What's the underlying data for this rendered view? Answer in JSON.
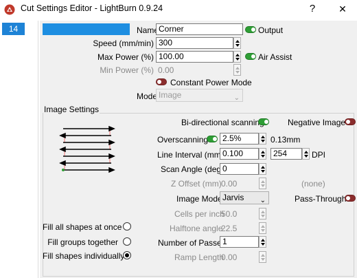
{
  "window": {
    "title": "Cut Settings Editor - LightBurn 0.9.24",
    "help_glyph": "?",
    "close_glyph": "✕",
    "app_icon": "lightburn-app-icon"
  },
  "layer": {
    "number": "14",
    "color": "#1e8ee1"
  },
  "fields": {
    "name_label": "Name",
    "name_value": "Corner",
    "output_label": "Output",
    "speed_label": "Speed (mm/min)",
    "speed_value": "300",
    "max_power_label": "Max Power (%)",
    "max_power_value": "100.00",
    "air_assist_label": "Air Assist",
    "min_power_label": "Min Power (%)",
    "min_power_value": "0.00",
    "constant_power_label": "Constant Power Mode",
    "mode_label": "Mode",
    "mode_value": "Image"
  },
  "image_settings": {
    "group_title": "Image Settings",
    "bidirectional_label": "Bi-directional scanning",
    "negative_image_label": "Negative Image",
    "overscanning_label": "Overscanning",
    "overscanning_value": "2.5%",
    "overscanning_mm": "0.13mm",
    "line_interval_label": "Line Interval (mm)",
    "line_interval_value": "0.100",
    "dpi_value": "254",
    "dpi_label": "DPI",
    "scan_angle_label": "Scan Angle (deg)",
    "scan_angle_value": "0",
    "z_offset_label": "Z Offset (mm)",
    "z_offset_value": "0.00",
    "z_offset_none": "(none)",
    "image_mode_label": "Image Mode",
    "image_mode_value": "Jarvis",
    "pass_through_label": "Pass-Through",
    "cells_label": "Cells per inch",
    "cells_value": "50.0",
    "halftone_label": "Halftone angle",
    "halftone_value": "22.5",
    "passes_label": "Number of Passes",
    "passes_value": "1",
    "ramp_label": "Ramp Length",
    "ramp_value": "0.00",
    "fill_all_label": "Fill all shapes at once",
    "fill_groups_label": "Fill groups together",
    "fill_individually_label": "Fill shapes individually"
  },
  "toggles": {
    "output": "on",
    "air_assist": "on",
    "constant_power": "off",
    "bidirectional": "on",
    "negative_image": "off",
    "overscanning": "on",
    "pass_through": "off"
  },
  "fill_mode_selected": "Fill shapes individually",
  "colors": {
    "toggle_on": "#2e9e35",
    "toggle_off": "#8b2d2d",
    "layer_blue": "#1e83d6",
    "scan_line_pink": "#f2a0a0"
  }
}
